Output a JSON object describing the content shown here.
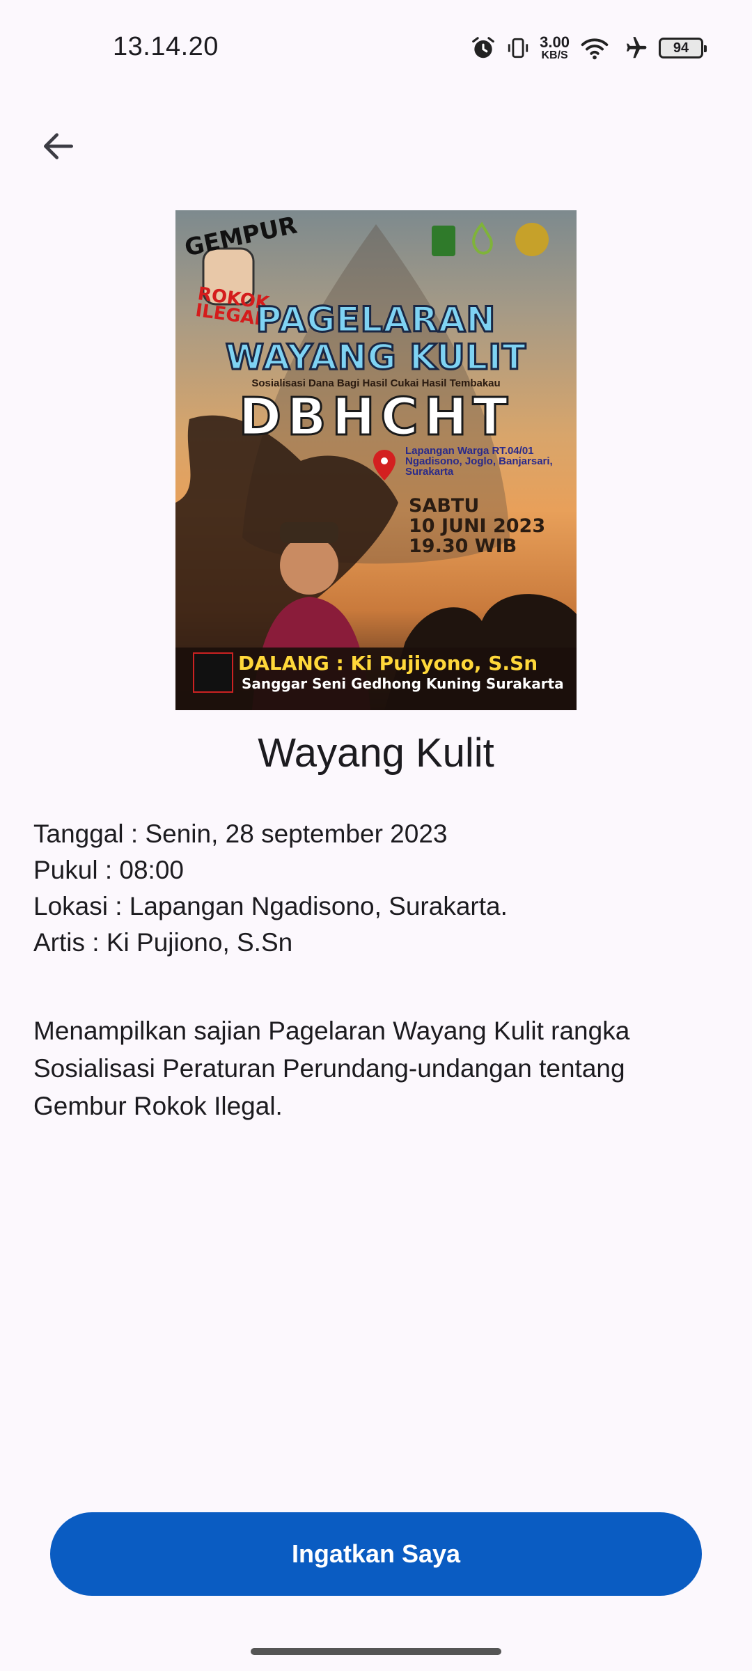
{
  "status_bar": {
    "time": "13.14.20",
    "net_speed_value": "3.00",
    "net_speed_unit": "KB/S",
    "battery": "94",
    "icons": [
      "alarm-icon",
      "vibrate-icon",
      "wifi-icon",
      "airplane-icon",
      "battery-icon"
    ]
  },
  "nav": {
    "back_icon": "arrow-left-icon"
  },
  "poster": {
    "gempur": "GEMPUR",
    "rokok": "ROKOK",
    "ilegal": "ILEGAL",
    "title_line1": "PAGELARAN",
    "title_line2": "WAYANG KULIT",
    "subtitle": "Sosialisasi Dana Bagi Hasil Cukai Hasil Tembakau",
    "big": "DBHCHT",
    "location_line1": "Lapangan Warga RT.04/01",
    "location_line2": "Ngadisono, Joglo, Banjarsari,",
    "location_line3": "Surakarta",
    "date_line1": "SABTU",
    "date_line2": "10 JUNI 2023",
    "date_line3": "19.30 WIB",
    "dalang": "DALANG : Ki Pujiyono, S.Sn",
    "sanggar": "Sanggar Seni Gedhong Kuning Surakarta"
  },
  "event": {
    "title": "Wayang Kulit",
    "tanggal": "Tanggal : Senin, 28 september 2023",
    "pukul": "Pukul : 08:00",
    "lokasi": "Lokasi : Lapangan Ngadisono, Surakarta.",
    "artis": "Artis : Ki Pujiono, S.Sn",
    "description": "Menampilkan sajian Pagelaran Wayang Kulit rangka Sosialisasi Peraturan Perundang-undangan tentang Gembur Rokok Ilegal."
  },
  "actions": {
    "remind_label": "Ingatkan Saya"
  },
  "colors": {
    "primary": "#0a5cc2",
    "background": "#fcf8fd"
  }
}
